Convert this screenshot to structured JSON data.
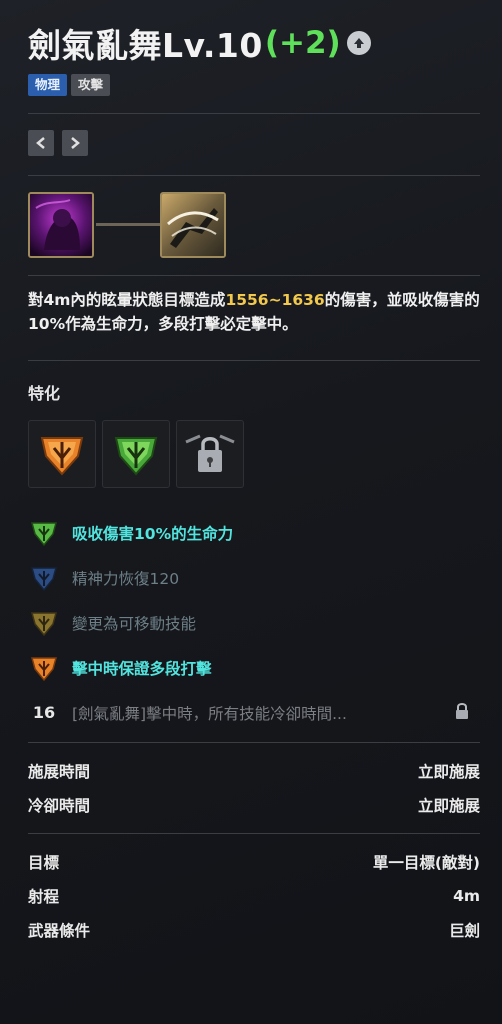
{
  "skill": {
    "title": "劍氣亂舞Lv.10",
    "bonus": "(+2)",
    "tags": [
      "物理",
      "攻擊"
    ]
  },
  "description": {
    "part1": "對4m內的眩暈狀態目標造成",
    "damage": "1556~1636",
    "part2": "的傷害，並吸收傷害的10%作為生命力，多段打擊必定擊中。"
  },
  "specialization": {
    "label": "特化",
    "items": [
      {
        "text": "吸收傷害10%的生命力",
        "gem": "green-gem-icon"
      },
      {
        "text": "精神力恢復120",
        "gem": "blue-gem-icon"
      },
      {
        "text": "變更為可移動技能",
        "gem": "yellow-gem-icon"
      },
      {
        "text": "擊中時保證多段打擊",
        "gem": "orange-gem-icon"
      }
    ],
    "locked": {
      "level": "16",
      "text": "[劍氣亂舞]擊中時，所有技能冷卻時間..."
    }
  },
  "stats": {
    "group1": [
      {
        "label": "施展時間",
        "value": "立即施展"
      },
      {
        "label": "冷卻時間",
        "value": "立即施展"
      }
    ],
    "group2": [
      {
        "label": "目標",
        "value": "單一目標(敵對)"
      },
      {
        "label": "射程",
        "value": "4m"
      },
      {
        "label": "武器條件",
        "value": "巨劍"
      }
    ]
  },
  "colors": {
    "accent_green": "#5fe05a",
    "highlight_gold": "#f2c94c",
    "active_cyan": "#52e4de",
    "tag_blue": "#2b5fae"
  }
}
